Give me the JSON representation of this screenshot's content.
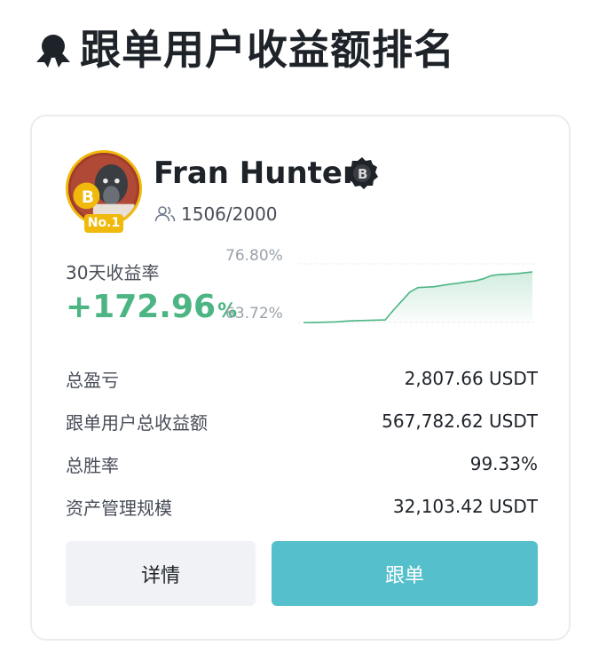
{
  "header": {
    "title": "跟单用户收益额排名",
    "icon": "medal-ribbon-icon"
  },
  "trader": {
    "name": "Fran Hunter",
    "rank_badge": "No.1",
    "followers": "1506/2000",
    "avatar_icon": "dog-with-bitcoin-avatar",
    "verified_icon": "binance-badge-icon"
  },
  "roi": {
    "label": "30天收益率",
    "value": "+172.96",
    "unit": "%",
    "chart_max_label": "76.80%",
    "chart_min_label": "63.72%"
  },
  "chart_data": {
    "type": "area",
    "ylim": [
      63.72,
      76.8
    ],
    "y_tick_labels": [
      "76.80%",
      "63.72%"
    ],
    "values": [
      63.72,
      63.7,
      63.75,
      63.8,
      63.85,
      64.0,
      64.1,
      64.15,
      64.2,
      64.25,
      64.3,
      66.5,
      68.5,
      70.5,
      71.5,
      71.6,
      71.7,
      72.0,
      72.3,
      72.5,
      72.8,
      73.0,
      73.5,
      74.2,
      74.4,
      74.5,
      74.6,
      74.8,
      75.0
    ],
    "grid": false,
    "color": "#4cb583"
  },
  "stats": [
    {
      "label": "总盈亏",
      "value": "2,807.66 USDT"
    },
    {
      "label": "跟单用户总收益额",
      "value": "567,782.62 USDT"
    },
    {
      "label": "总胜率",
      "value": "99.33%"
    },
    {
      "label": "资产管理规模",
      "value": "32,103.42 USDT"
    }
  ],
  "buttons": {
    "details": "详情",
    "copy": "跟单"
  },
  "colors": {
    "positive": "#4cb583",
    "accent_button": "#55bfcb",
    "badge": "#f0b90b"
  }
}
